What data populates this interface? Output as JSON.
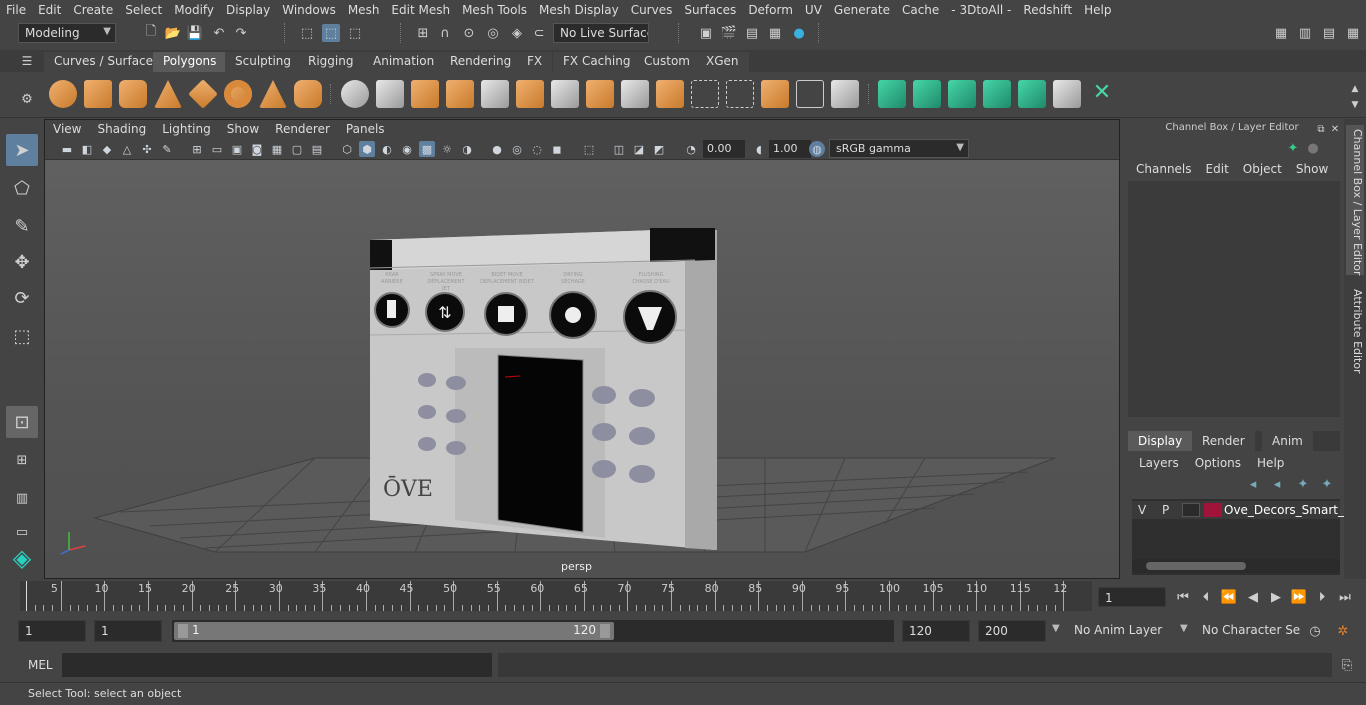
{
  "menubar": [
    "File",
    "Edit",
    "Create",
    "Select",
    "Modify",
    "Display",
    "Windows",
    "Mesh",
    "Edit Mesh",
    "Mesh Tools",
    "Mesh Display",
    "Curves",
    "Surfaces",
    "Deform",
    "UV",
    "Generate",
    "Cache",
    "- 3DtoAll -",
    "Redshift",
    "Help"
  ],
  "status": {
    "workspace": "Modeling",
    "live_surface": "No Live Surface"
  },
  "shelf_tabs": [
    "Curves / Surfaces",
    "Polygons",
    "Sculpting",
    "Rigging",
    "Animation",
    "Rendering",
    "FX",
    "FX Caching",
    "Custom",
    "XGen"
  ],
  "viewport": {
    "menu": [
      "View",
      "Shading",
      "Lighting",
      "Show",
      "Renderer",
      "Panels"
    ],
    "exposure": "0.00",
    "gamma": "1.00",
    "color_space": "sRGB gamma",
    "camera": "persp"
  },
  "model": {
    "brand": "ŌVE",
    "buttons": [
      {
        "top": "REAR",
        "bottom": "ARRIÈRE"
      },
      {
        "top": "SPRAY MOVE",
        "bottom": "DÉPLACEMENT JET"
      },
      {
        "top": "BIDET MOVE",
        "bottom": "DÉPLACEMENT BIDET"
      },
      {
        "top": "DRYING",
        "bottom": "SÉCHAGE"
      },
      {
        "top": "FLUSHING",
        "bottom": "CHASSE D'EAU"
      }
    ]
  },
  "channel_box": {
    "title": "Channel Box / Layer Editor",
    "menu": [
      "Channels",
      "Edit",
      "Object",
      "Show"
    ],
    "layer_tabs": [
      "Display",
      "Render",
      "Anim"
    ],
    "layer_menu": [
      "Layers",
      "Options",
      "Help"
    ],
    "layer": {
      "v": "V",
      "p": "P",
      "name": "Ove_Decors_Smart_Toi",
      "color": "#a0143a"
    }
  },
  "side_tabs": [
    "Channel Box / Layer Editor",
    "Attribute Editor"
  ],
  "timeline": {
    "ticks": [
      "5",
      "10",
      "15",
      "20",
      "25",
      "30",
      "35",
      "40",
      "45",
      "50",
      "55",
      "60",
      "65",
      "70",
      "75",
      "80",
      "85",
      "90",
      "95",
      "100",
      "105",
      "110",
      "115",
      "12"
    ],
    "start_label": "1",
    "current_frame": "1"
  },
  "range": {
    "start": "1",
    "start2": "1",
    "slider_start": "1",
    "slider_end": "120",
    "end": "120",
    "end2": "200",
    "anim_layer": "No Anim Layer",
    "char_set": "No Character Set"
  },
  "cmd": {
    "label": "MEL"
  },
  "help": "Select Tool: select an object"
}
